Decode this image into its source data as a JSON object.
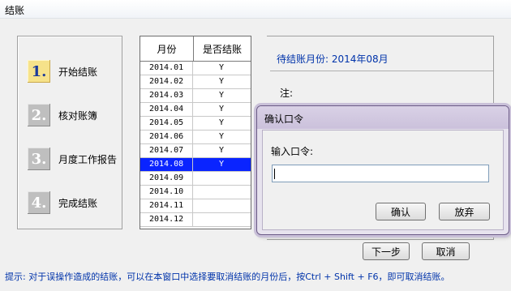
{
  "window": {
    "title": "结账"
  },
  "steps": [
    {
      "num": "1.",
      "label": "开始结账",
      "active": true
    },
    {
      "num": "2.",
      "label": "核对账簿",
      "active": false
    },
    {
      "num": "3.",
      "label": "月度工作报告",
      "active": false
    },
    {
      "num": "4.",
      "label": "完成结账",
      "active": false
    }
  ],
  "month_table": {
    "headers": [
      "月份",
      "是否结账"
    ],
    "rows": [
      {
        "month": "2014.01",
        "closed": "Y"
      },
      {
        "month": "2014.02",
        "closed": "Y"
      },
      {
        "month": "2014.03",
        "closed": "Y"
      },
      {
        "month": "2014.04",
        "closed": "Y"
      },
      {
        "month": "2014.05",
        "closed": "Y"
      },
      {
        "month": "2014.06",
        "closed": "Y"
      },
      {
        "month": "2014.07",
        "closed": "Y"
      },
      {
        "month": "2014.08",
        "closed": "Y"
      },
      {
        "month": "2014.09",
        "closed": ""
      },
      {
        "month": "2014.10",
        "closed": ""
      },
      {
        "month": "2014.11",
        "closed": ""
      },
      {
        "month": "2014.12",
        "closed": ""
      }
    ],
    "selected_month": "2014.08"
  },
  "info": {
    "pending_label": "待结账月份: 2014年08月",
    "note_label": "注:"
  },
  "buttons": {
    "next": "下一步",
    "cancel": "取消"
  },
  "hint": "提示: 对于误操作造成的结账，可以在本窗口中选择要取消结账的月份后，按Ctrl + Shift + F6，即可取消结账。",
  "dialog": {
    "title": "确认口令",
    "prompt": "输入口令:",
    "password_value": "",
    "ok": "确认",
    "abandon": "放弃"
  },
  "colors": {
    "selection": "#0a24ff",
    "hint_text": "#0033aa",
    "active_step": "#f6e28a"
  }
}
